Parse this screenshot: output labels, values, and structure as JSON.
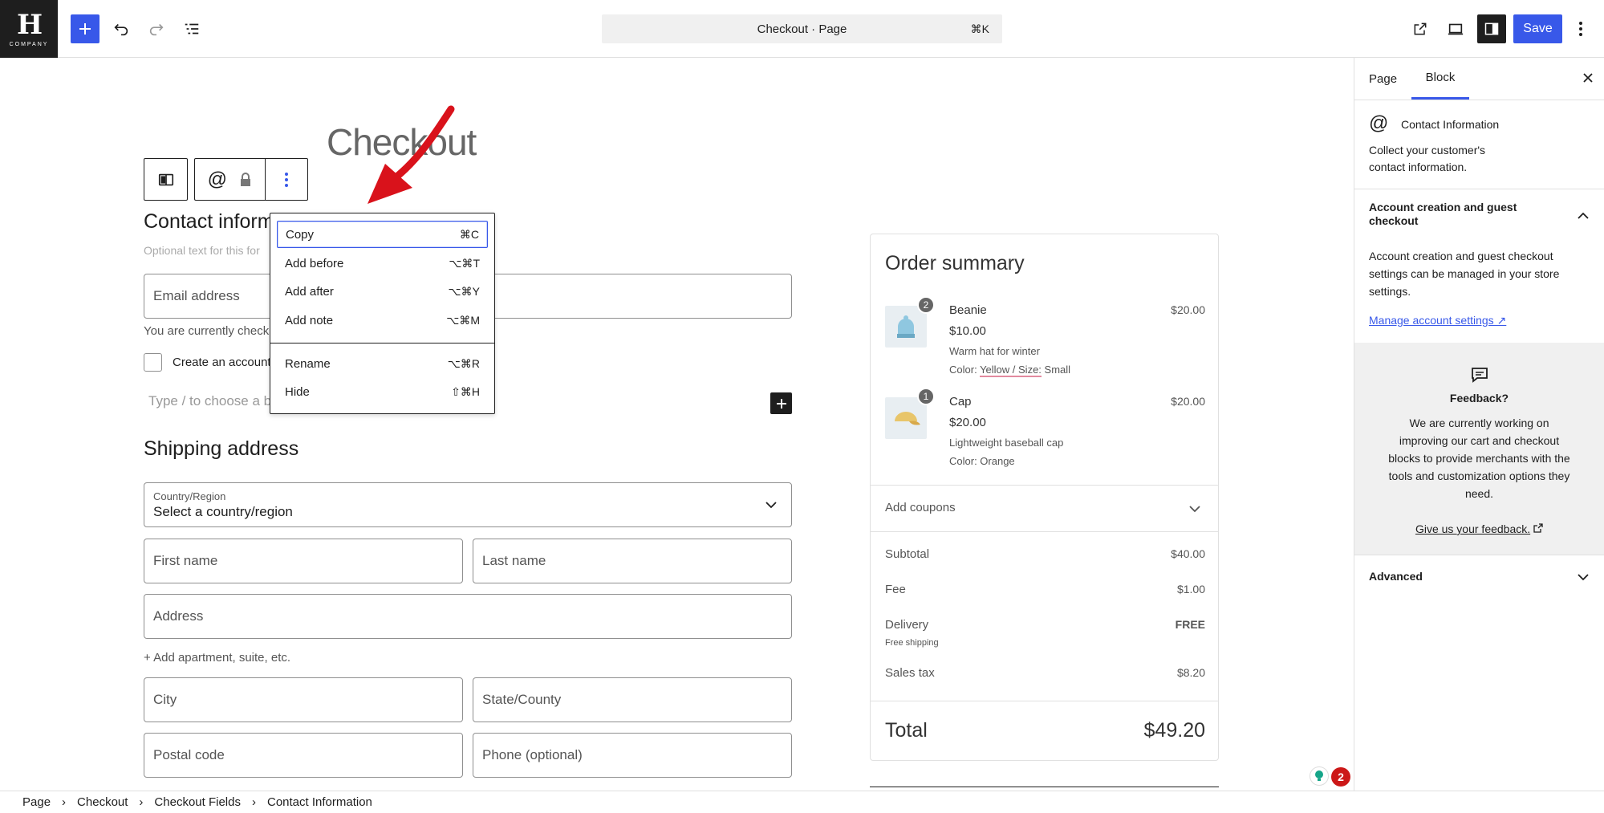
{
  "topbar": {
    "logo_text": "COMPANY",
    "command_title": "Checkout · Page",
    "command_shortcut": "⌘K",
    "save_label": "Save"
  },
  "canvas": {
    "page_heading": "Checkout",
    "contact_title": "Contact inform",
    "contact_hint": "Optional text for this for",
    "email_placeholder": "Email address",
    "checking_text": "You are currently checki",
    "create_account_label": "Create an account",
    "block_placeholder": "Type / to choose a bl",
    "shipping_title": "Shipping address",
    "country_label": "Country/Region",
    "country_value": "Select a country/region",
    "first_name": "First name",
    "last_name": "Last name",
    "address": "Address",
    "add_apartment": "+ Add apartment, suite, etc.",
    "city": "City",
    "state": "State/County",
    "postal": "Postal code",
    "phone": "Phone (optional)"
  },
  "context_menu": {
    "items": [
      {
        "label": "Copy",
        "shortcut": "⌘C"
      },
      {
        "label": "Add before",
        "shortcut": "⌥⌘T"
      },
      {
        "label": "Add after",
        "shortcut": "⌥⌘Y"
      },
      {
        "label": "Add note",
        "shortcut": "⌥⌘M"
      },
      {
        "label": "Rename",
        "shortcut": "⌥⌘R"
      },
      {
        "label": "Hide",
        "shortcut": "⇧⌘H"
      }
    ]
  },
  "order_summary": {
    "title": "Order summary",
    "items": [
      {
        "qty": "2",
        "name": "Beanie",
        "line_total": "$20.00",
        "price": "$10.00",
        "desc": "Warm hat for winter",
        "attr_label": "Color:",
        "attr_value": "Yellow / Size:",
        "attr_extra": "Small"
      },
      {
        "qty": "1",
        "name": "Cap",
        "line_total": "$20.00",
        "price": "$20.00",
        "desc": "Lightweight baseball cap",
        "attr_label": "Color: Orange"
      }
    ],
    "coupons_label": "Add coupons",
    "subtotal_label": "Subtotal",
    "subtotal_value": "$40.00",
    "fee_label": "Fee",
    "fee_value": "$1.00",
    "delivery_label": "Delivery",
    "delivery_value": "FREE",
    "delivery_note": "Free shipping",
    "tax_label": "Sales tax",
    "tax_value": "$8.20",
    "total_label": "Total",
    "total_value": "$49.20"
  },
  "sidebar": {
    "tab_page": "Page",
    "tab_block": "Block",
    "block_name": "Contact Information",
    "block_desc_1": "Collect your customer's",
    "block_desc_2": "contact information.",
    "account_section_1": "Account creation and guest",
    "account_section_2": "checkout",
    "account_text_1": "Account creation and guest checkout",
    "account_text_2": "settings can be managed in your store",
    "account_text_3": "settings.",
    "manage_link": "Manage account settings ↗",
    "feedback_title": "Feedback?",
    "feedback_1": "We are currently working on",
    "feedback_2": "improving our cart and checkout",
    "feedback_3": "blocks to provide merchants with the",
    "feedback_4": "tools and customization options they",
    "feedback_5": "need.",
    "feedback_link": "Give us your feedback.",
    "advanced_label": "Advanced"
  },
  "breadcrumb": [
    "Page",
    "Checkout",
    "Checkout Fields",
    "Contact Information"
  ],
  "notifications": {
    "count": "2"
  },
  "colors": {
    "accent": "#3858e9",
    "arrow": "#d9121b",
    "badge": "#cc1818"
  }
}
